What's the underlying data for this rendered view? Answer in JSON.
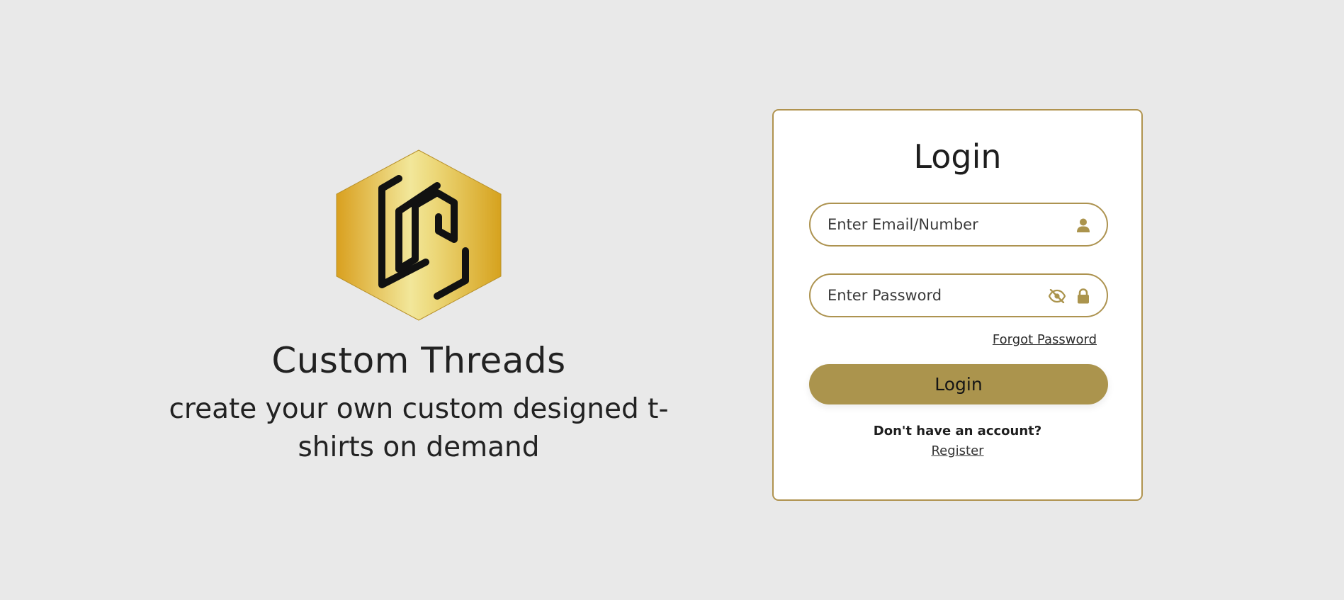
{
  "brand": {
    "name": "Custom Threads",
    "tagline": "create your own custom designed t-shirts on demand",
    "logo_icon": "custom-threads-hexagon-logo",
    "logo_colors": {
      "gold_dark": "#d9a01f",
      "gold_light": "#f2e79a",
      "mark": "#111111"
    }
  },
  "login": {
    "title": "Login",
    "email_placeholder": "Enter Email/Number",
    "email_icon": "user-icon",
    "password_placeholder": "Enter Password",
    "password_icons": [
      "eye-slash-icon",
      "lock-icon"
    ],
    "forgot_password": "Forgot Password",
    "submit_label": "Login",
    "no_account_text": "Don't have an account?",
    "register_link": "Register"
  },
  "colors": {
    "page_background": "#e9e9e9",
    "card_background": "#ffffff",
    "accent": "#ab944d"
  }
}
